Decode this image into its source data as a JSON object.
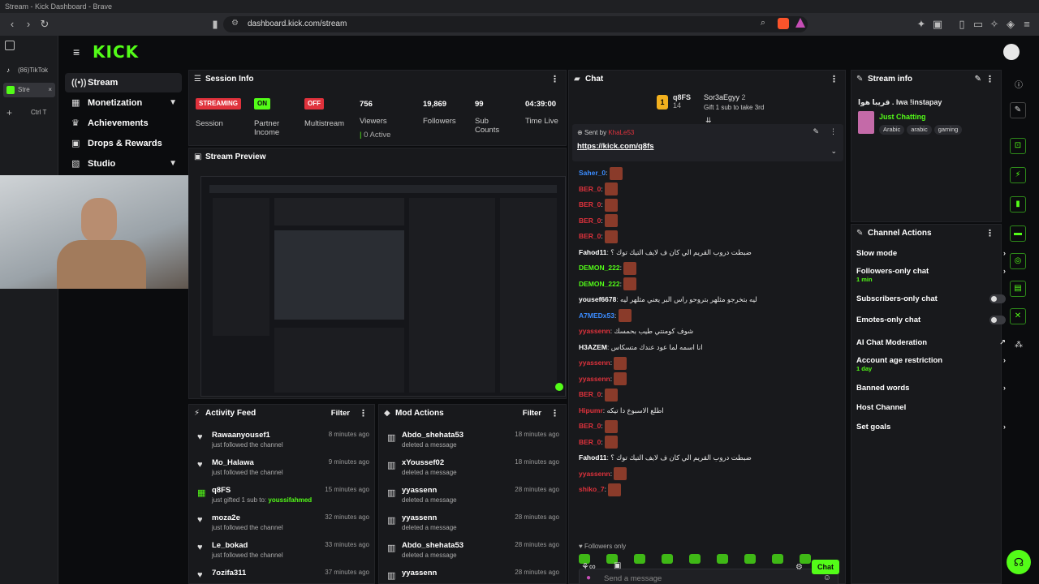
{
  "browser": {
    "window_title": "Stream - Kick Dashboard - Brave",
    "url": "dashboard.kick.com/stream",
    "tabs": [
      {
        "label": "(86)TikTok"
      },
      {
        "label": "Stre"
      }
    ],
    "new_tab_hint": "Ctrl T"
  },
  "app": {
    "logo": "KICK"
  },
  "sidebar": {
    "items": [
      {
        "label": "Stream"
      },
      {
        "label": "Monetization"
      },
      {
        "label": "Achievements"
      },
      {
        "label": "Drops & Rewards"
      },
      {
        "label": "Studio"
      }
    ]
  },
  "session_info": {
    "title": "Session Info",
    "stats": [
      {
        "badge": "STREAMING",
        "label": "Session"
      },
      {
        "badge": "ON",
        "label": "Partner Income"
      },
      {
        "badge": "OFF",
        "label": "Multistream"
      },
      {
        "value": "756",
        "label": "Viewers",
        "extra": "0 Active"
      },
      {
        "value": "19,869",
        "label": "Followers"
      },
      {
        "value": "99",
        "label": "Sub Counts"
      },
      {
        "value": "04:39:00",
        "label": "Time Live"
      }
    ]
  },
  "stream_preview": {
    "title": "Stream Preview"
  },
  "activity_feed": {
    "title": "Activity Feed",
    "filter": "Filter",
    "items": [
      {
        "user": "Rawaanyousef1",
        "text": "just followed the channel",
        "time": "8 minutes ago"
      },
      {
        "user": "Mo_Halawa",
        "text": "just followed the channel",
        "time": "9 minutes ago"
      },
      {
        "user": "q8FS",
        "text": "just gifted 1 sub to:",
        "target": "youssifahmed",
        "time": "15 minutes ago"
      },
      {
        "user": "moza2e",
        "text": "just followed the channel",
        "time": "32 minutes ago"
      },
      {
        "user": "Le_bokad",
        "text": "just followed the channel",
        "time": "33 minutes ago"
      },
      {
        "user": "7ozifa311",
        "text": "",
        "time": "37 minutes ago"
      }
    ]
  },
  "mod_actions": {
    "title": "Mod Actions",
    "filter": "Filter",
    "items": [
      {
        "user": "Abdo_shehata53",
        "text": "deleted a message",
        "time": "18 minutes ago"
      },
      {
        "user": "xYoussef02",
        "text": "deleted a message",
        "time": "18 minutes ago"
      },
      {
        "user": "yyassenn",
        "text": "deleted a message",
        "time": "28 minutes ago"
      },
      {
        "user": "yyassenn",
        "text": "deleted a message",
        "time": "28 minutes ago"
      },
      {
        "user": "Abdo_shehata53",
        "text": "deleted a message",
        "time": "28 minutes ago"
      },
      {
        "user": "yyassenn",
        "text": "",
        "time": "28 minutes ago"
      }
    ]
  },
  "chat": {
    "title": "Chat",
    "gifter": {
      "user": "q8FS",
      "count": "14",
      "target": "Sor3aEgyy",
      "target_count": "2",
      "note": "Gift 1 sub to take 3rd"
    },
    "pinned": {
      "sent_by": "Sent by",
      "sender": "KhaLe53",
      "link": "https://kick.com/q8fs"
    },
    "messages": [
      {
        "user": "Saher_0",
        "color": "#3b8cff",
        "text": ""
      },
      {
        "user": "BER_0",
        "color": "#e0323c",
        "text": ""
      },
      {
        "user": "BER_0",
        "color": "#e0323c",
        "text": ""
      },
      {
        "user": "BER_0",
        "color": "#e0323c",
        "text": ""
      },
      {
        "user": "BER_0",
        "color": "#e0323c",
        "text": ""
      },
      {
        "user": "Fahod11",
        "color": "#ffffff",
        "text": "ضبطت دروب القريم الي كان ف لايف التيك توك ؟"
      },
      {
        "user": "DEMON_222",
        "color": "#53fc18",
        "text": ""
      },
      {
        "user": "DEMON_222",
        "color": "#53fc18",
        "text": ""
      },
      {
        "user": "yousef6678",
        "color": "#ffffff",
        "text": "ليه بتخرجو مثلهر بتروحو راس البر يعني مثلهر ليه"
      },
      {
        "user": "A7MEDx53",
        "color": "#3b8cff",
        "text": ""
      },
      {
        "user": "yyassenn",
        "color": "#e0323c",
        "text": "شوف كومنتي طيب بحمسك"
      },
      {
        "user": "H3AZEM",
        "color": "#ffffff",
        "text": "انا اسمه لما عود عندك متسكاس"
      },
      {
        "user": "yyassenn",
        "color": "#e0323c",
        "text": ""
      },
      {
        "user": "yyassenn",
        "color": "#e0323c",
        "text": ""
      },
      {
        "user": "BER_0",
        "color": "#e0323c",
        "text": ""
      },
      {
        "user": "Hipumr",
        "color": "#e0323c",
        "text": "اطلع الاسبوع دا تيكه"
      },
      {
        "user": "BER_0",
        "color": "#e0323c",
        "text": ""
      },
      {
        "user": "BER_0",
        "color": "#e0323c",
        "text": ""
      },
      {
        "user": "Fahod11",
        "color": "#ffffff",
        "text": "ضبطت دروب القريم الي كان ف لايف التيك توك ؟"
      },
      {
        "user": "yyassenn",
        "color": "#e0323c",
        "text": ""
      },
      {
        "user": "shiko_7",
        "color": "#e0323c",
        "text": ""
      }
    ],
    "followers_only": "Followers only",
    "input_placeholder": "Send a message",
    "send_label": "Chat"
  },
  "stream_info": {
    "title": "Stream info",
    "stream_title": "قريبا هوا . lwa !instapay",
    "category": "Just Chatting",
    "tags": [
      "Arabic",
      "arabic",
      "gaming"
    ]
  },
  "channel_actions": {
    "title": "Channel Actions",
    "items": [
      {
        "label": "Slow mode",
        "kind": "chevron",
        "sub": ""
      },
      {
        "label": "Followers-only chat",
        "kind": "chevron",
        "sub": "1 min"
      },
      {
        "label": "Subscribers-only chat",
        "kind": "toggle",
        "sub": ""
      },
      {
        "label": "Emotes-only chat",
        "kind": "toggle",
        "sub": ""
      },
      {
        "label": "AI Chat Moderation",
        "kind": "external",
        "sub": ""
      },
      {
        "label": "Account age restriction",
        "kind": "chevron",
        "sub": "1 day"
      },
      {
        "label": "Banned words",
        "kind": "chevron",
        "sub": ""
      },
      {
        "label": "Host Channel",
        "kind": "none",
        "sub": ""
      },
      {
        "label": "Set goals",
        "kind": "chevron",
        "sub": ""
      }
    ]
  },
  "colors": {
    "accent": "#53fc18",
    "danger": "#e0323c",
    "panel": "#18191c"
  }
}
